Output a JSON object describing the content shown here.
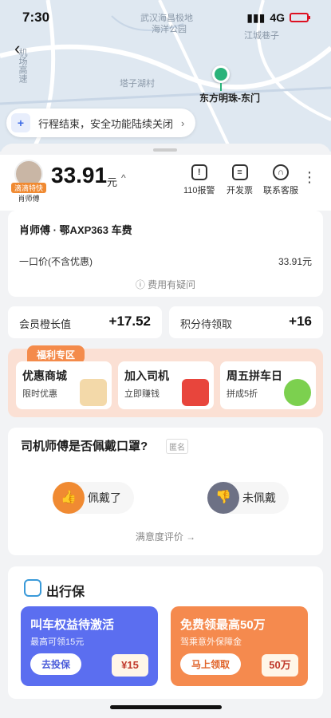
{
  "status": {
    "time": "7:30",
    "network": "4G"
  },
  "map": {
    "labels": [
      "武汉海昌极地",
      "海洋公园",
      "江城巷子",
      "塔子湖村",
      "机场高速"
    ],
    "destination": "东方明珠-东门"
  },
  "trip_banner": {
    "text": "行程结束，安全功能陆续关闭"
  },
  "fare": {
    "amount": "33.91",
    "unit": "元",
    "driver_tag": "滴滴特快",
    "driver_name": "肖师傅",
    "actions": [
      {
        "label": "110报警",
        "icon": "alarm-icon"
      },
      {
        "label": "开发票",
        "icon": "invoice-icon"
      },
      {
        "label": "联系客服",
        "icon": "headset-icon"
      }
    ]
  },
  "detail": {
    "driver_line": "肖师傅 · 鄂AXP363 车费",
    "price_label": "一口价(不含优惠)",
    "price_value": "33.91元",
    "doubt": "费用有疑问"
  },
  "member": {
    "label": "会员橙长值",
    "value": "+17.52"
  },
  "points": {
    "label": "积分待领取",
    "value": "+16"
  },
  "welfare": {
    "tag": "福利专区",
    "items": [
      {
        "title": "优惠商城",
        "sub": "限时优惠"
      },
      {
        "title": "加入司机",
        "sub": "立即赚钱"
      },
      {
        "title": "周五拼车日",
        "sub": "拼成5折"
      }
    ]
  },
  "mask": {
    "question": "司机师傅是否佩戴口罩?",
    "anonymous": "匿名",
    "yes": "佩戴了",
    "no": "未佩戴",
    "satisfaction": "满意度评价 →"
  },
  "insurance": {
    "title": "出行保",
    "left": {
      "title": "叫车权益待激活",
      "sub": "最高可领15元",
      "button": "去投保",
      "badge": "¥15"
    },
    "right": {
      "title": "免费领最高50万",
      "sub": "驾乘意外保障金",
      "button": "马上领取",
      "badge": "50万"
    }
  },
  "colors": {
    "accent": "#f48b4b",
    "green": "#2ab37a",
    "blue": "#3b6ae6"
  }
}
